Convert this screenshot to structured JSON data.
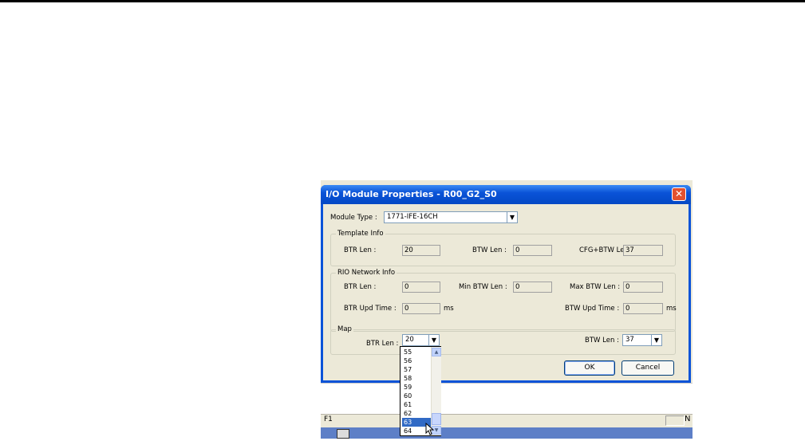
{
  "dialog": {
    "title": "I/O Module Properties - R00_G2_S0",
    "close_glyph": "✕",
    "module_type_label": "Module Type :",
    "module_type_value": "1771-IFE-16CH",
    "template_info": {
      "title": "Template Info",
      "btr_len_label": "BTR Len :",
      "btr_len_value": "20",
      "btw_len_label": "BTW Len :",
      "btw_len_value": "0",
      "cfg_btw_len_label": "CFG+BTW Len :",
      "cfg_btw_len_value": "37"
    },
    "rio_network_info": {
      "title": "RIO Network Info",
      "btr_len_label": "BTR Len :",
      "btr_len_value": "0",
      "min_btw_len_label": "Min BTW  Len :",
      "min_btw_len_value": "0",
      "max_btw_len_label": "Max BTW Len :",
      "max_btw_len_value": "0",
      "btr_upd_time_label": "BTR Upd  Time :",
      "btr_upd_time_value": "0",
      "btr_upd_time_unit": "ms",
      "btw_upd_time_label": "BTW Upd Time :",
      "btw_upd_time_value": "0",
      "btw_upd_time_unit": "ms"
    },
    "map": {
      "title": "Map",
      "btr_len_label": "BTR Len :",
      "btr_len_value": "20",
      "btw_len_label": "BTW Len :",
      "btw_len_value": "37",
      "dropdown_items": [
        "55",
        "56",
        "57",
        "58",
        "59",
        "60",
        "61",
        "62",
        "63",
        "64"
      ],
      "dropdown_selected": "63"
    },
    "ok_label": "OK",
    "cancel_label": "Cancel"
  },
  "app": {
    "status_left": "F1",
    "status_right": "N"
  },
  "colors": {
    "title_bar": "#0a53d8",
    "close_button": "#e2512f",
    "dialog_background": "#ece9d8",
    "selection": "#316ac5"
  },
  "icons": {
    "close": "close-icon",
    "combo_arrow": "chevron-down-icon",
    "scroll_up": "scroll-up-arrow-icon",
    "scroll_down": "scroll-down-arrow-icon",
    "cursor": "mouse-pointer-icon"
  }
}
